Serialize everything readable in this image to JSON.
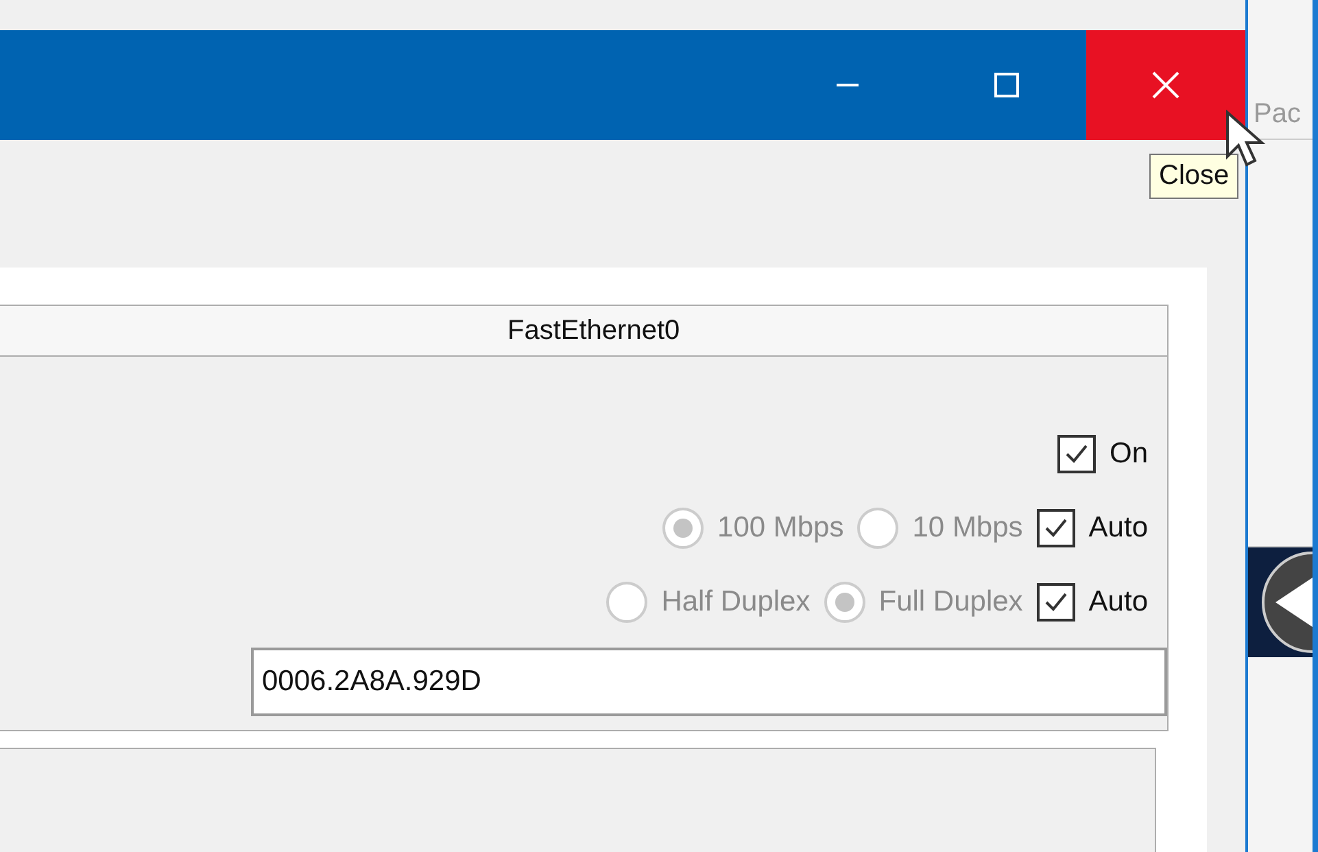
{
  "window": {
    "controls": [
      {
        "kind": "minimize",
        "hovered": false
      },
      {
        "kind": "maximize",
        "hovered": false
      },
      {
        "kind": "close",
        "hovered": true
      }
    ],
    "tooltip": "Close"
  },
  "background_window": {
    "partial_text": "Pac"
  },
  "port_panel": {
    "title": "FastEthernet0",
    "port_status": {
      "label": "On",
      "checked": true
    },
    "bandwidth": {
      "disabled": true,
      "options": [
        {
          "label": "100 Mbps",
          "selected": true
        },
        {
          "label": "10 Mbps",
          "selected": false
        }
      ],
      "auto": {
        "label": "Auto",
        "checked": true
      }
    },
    "duplex": {
      "disabled": true,
      "options": [
        {
          "label": "Half Duplex",
          "selected": false
        },
        {
          "label": "Full Duplex",
          "selected": true
        }
      ],
      "auto": {
        "label": "Auto",
        "checked": true
      }
    },
    "mac_address": "0006.2A8A.929D"
  }
}
